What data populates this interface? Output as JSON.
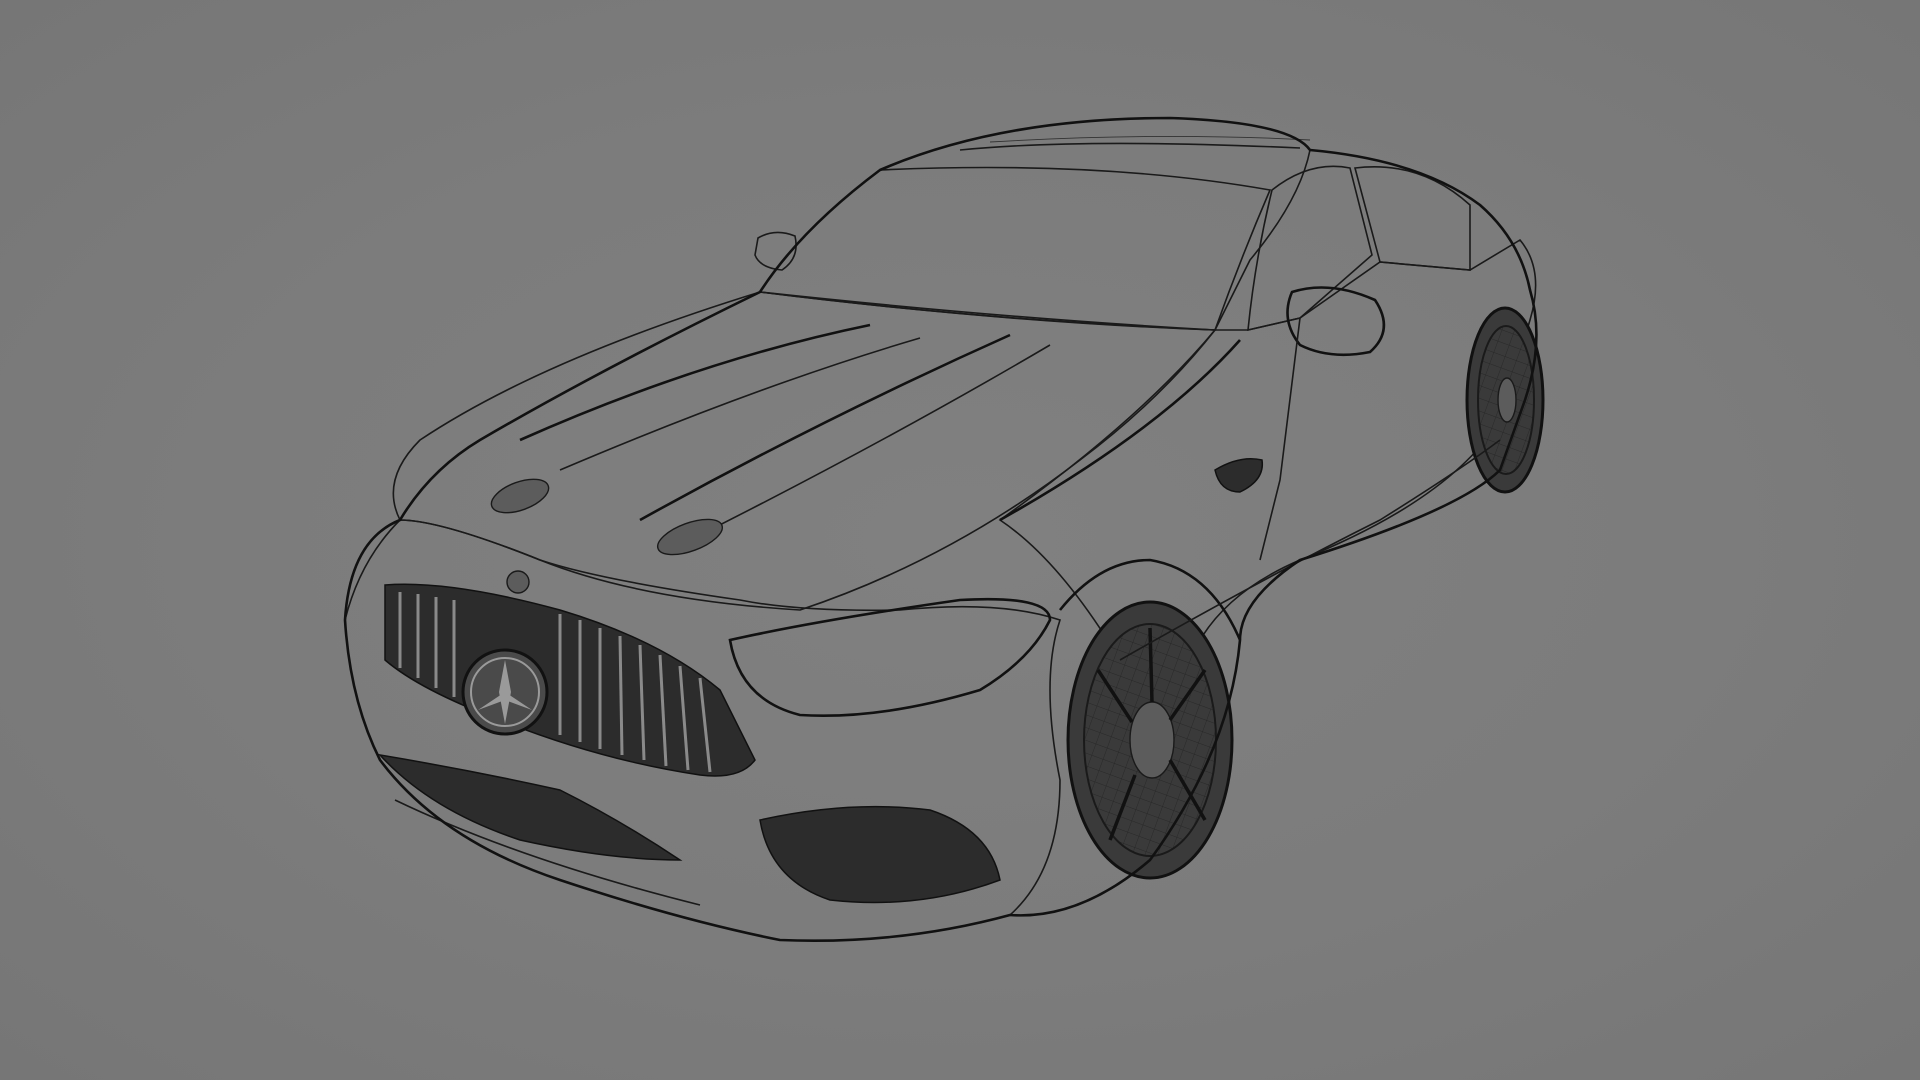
{
  "viewport": {
    "background_color": "#7b7b7b",
    "wire_color": "#1c1c1c",
    "display_mode": "wireframe"
  },
  "model": {
    "icon": "car-wireframe-icon"
  }
}
